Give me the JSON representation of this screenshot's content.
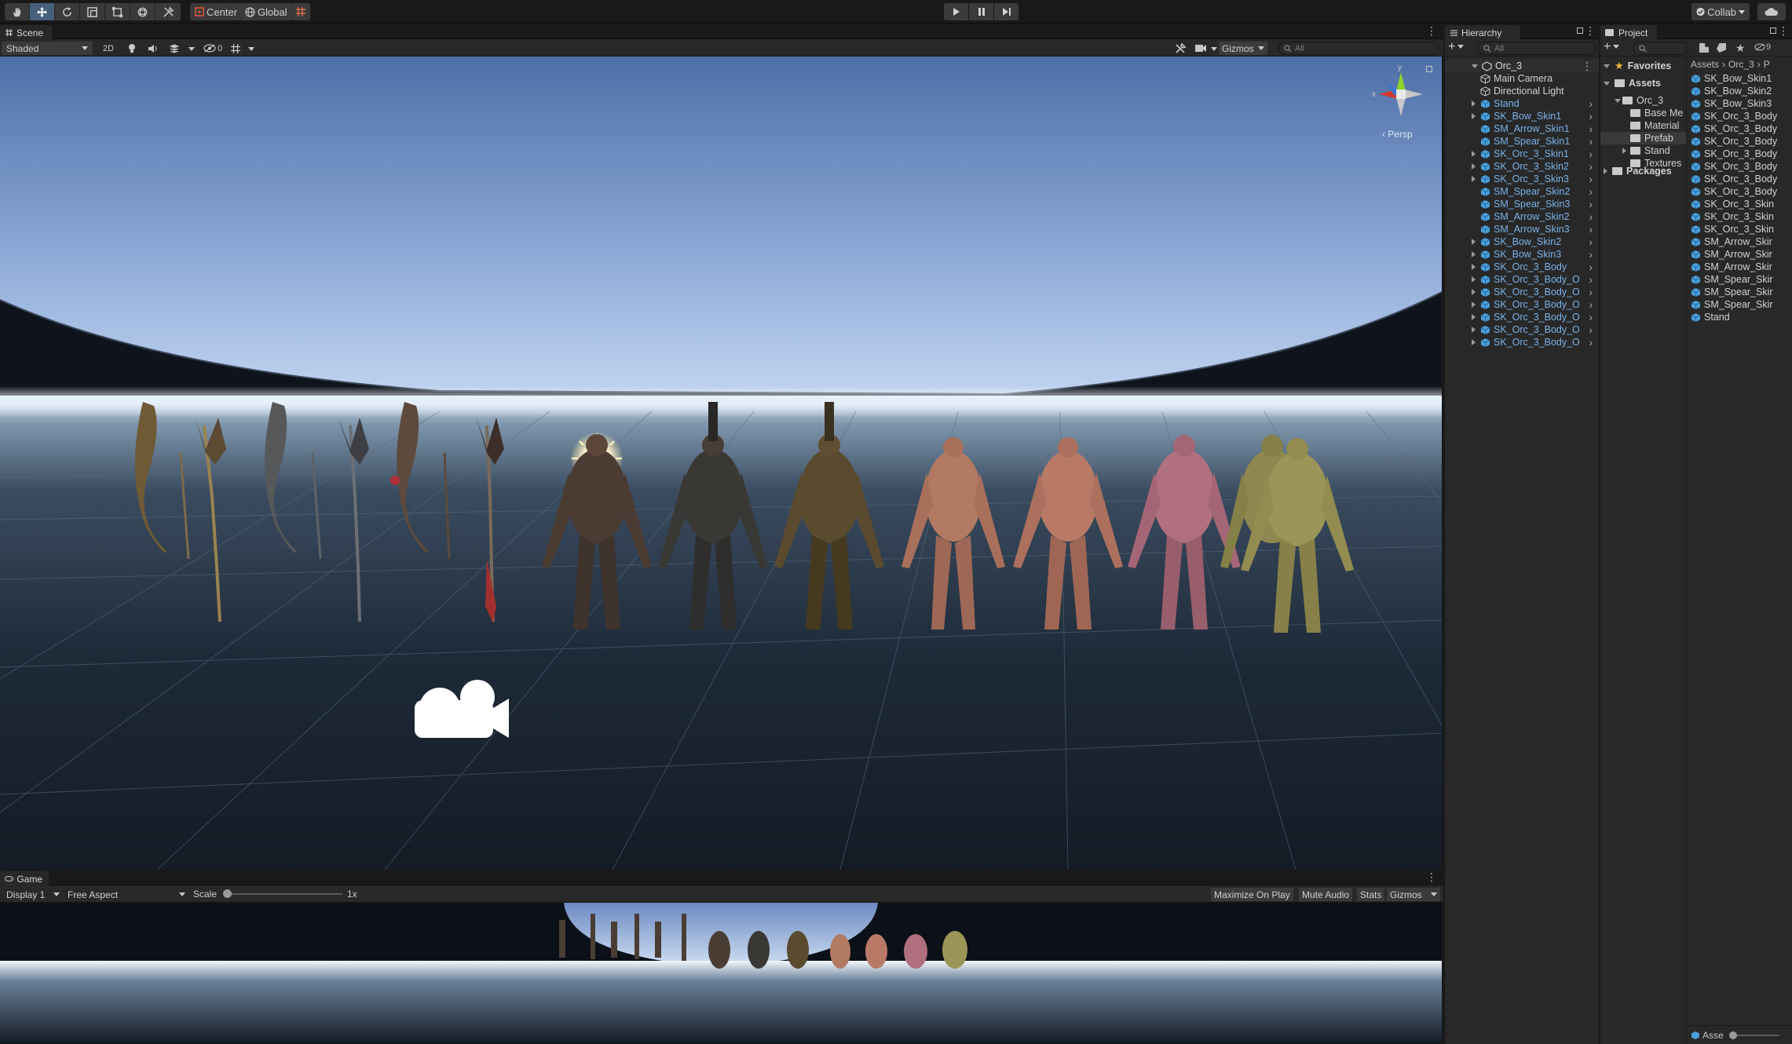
{
  "toolbar": {
    "pivot_label": "Center",
    "space_label": "Global",
    "collab_label": "Collab"
  },
  "scene": {
    "tab_label": "Scene",
    "shading_mode": "Shaded",
    "mode_2d": "2D",
    "hidden_count": "0",
    "gizmos_label": "Gizmos",
    "search_placeholder": "All",
    "persp_label": "‹ Persp",
    "axis_x": "x",
    "axis_y": "y"
  },
  "game": {
    "tab_label": "Game",
    "display": "Display 1",
    "aspect": "Free Aspect",
    "scale_label": "Scale",
    "scale_value": "1x",
    "scale_level": 0.0,
    "maximize_label": "Maximize On Play",
    "mute_label": "Mute Audio",
    "stats_label": "Stats",
    "gizmos_label": "Gizmos"
  },
  "hierarchy": {
    "tab_label": "Hierarchy",
    "search_placeholder": "All",
    "root": "Orc_3",
    "items": [
      {
        "label": "Main Camera",
        "type": "object",
        "expandable": false
      },
      {
        "label": "Directional Light",
        "type": "object",
        "expandable": false
      },
      {
        "label": "Stand",
        "type": "prefab",
        "expandable": true
      },
      {
        "label": "SK_Bow_Skin1",
        "type": "prefab",
        "expandable": true
      },
      {
        "label": "SM_Arrow_Skin1",
        "type": "prefab",
        "expandable": false
      },
      {
        "label": "SM_Spear_Skin1",
        "type": "prefab",
        "expandable": false
      },
      {
        "label": "SK_Orc_3_Skin1",
        "type": "prefab",
        "expandable": true
      },
      {
        "label": "SK_Orc_3_Skin2",
        "type": "prefab",
        "expandable": true
      },
      {
        "label": "SK_Orc_3_Skin3",
        "type": "prefab",
        "expandable": true
      },
      {
        "label": "SM_Spear_Skin2",
        "type": "prefab",
        "expandable": false
      },
      {
        "label": "SM_Spear_Skin3",
        "type": "prefab",
        "expandable": false
      },
      {
        "label": "SM_Arrow_Skin2",
        "type": "prefab",
        "expandable": false
      },
      {
        "label": "SM_Arrow_Skin3",
        "type": "prefab",
        "expandable": false
      },
      {
        "label": "SK_Bow_Skin2",
        "type": "prefab",
        "expandable": true
      },
      {
        "label": "SK_Bow_Skin3",
        "type": "prefab",
        "expandable": true
      },
      {
        "label": "SK_Orc_3_Body",
        "type": "prefab",
        "expandable": true
      },
      {
        "label": "SK_Orc_3_Body_O",
        "type": "prefab",
        "expandable": true
      },
      {
        "label": "SK_Orc_3_Body_O",
        "type": "prefab",
        "expandable": true
      },
      {
        "label": "SK_Orc_3_Body_O",
        "type": "prefab",
        "expandable": true
      },
      {
        "label": "SK_Orc_3_Body_O",
        "type": "prefab",
        "expandable": true
      },
      {
        "label": "SK_Orc_3_Body_O",
        "type": "prefab",
        "expandable": true
      },
      {
        "label": "SK_Orc_3_Body_O",
        "type": "prefab",
        "expandable": true
      }
    ]
  },
  "project": {
    "tab_label": "Project",
    "favorites_label": "Favorites",
    "assets_label": "Assets",
    "packages_label": "Packages",
    "breadcrumb": [
      "Assets",
      "Orc_3",
      "P"
    ],
    "hidden_count": "9",
    "tree": [
      {
        "label": "Orc_3",
        "level": 1,
        "open": true
      },
      {
        "label": "Base Me",
        "level": 2,
        "open": false
      },
      {
        "label": "Material",
        "level": 2,
        "open": false
      },
      {
        "label": "Prefab",
        "level": 2,
        "open": false,
        "selected": true
      },
      {
        "label": "Stand",
        "level": 2,
        "open": false,
        "expandable": true
      },
      {
        "label": "Textures",
        "level": 2,
        "open": false
      }
    ],
    "files": [
      "SK_Bow_Skin1",
      "SK_Bow_Skin2",
      "SK_Bow_Skin3",
      "SK_Orc_3_Body",
      "SK_Orc_3_Body",
      "SK_Orc_3_Body",
      "SK_Orc_3_Body",
      "SK_Orc_3_Body",
      "SK_Orc_3_Body",
      "SK_Orc_3_Body",
      "SK_Orc_3_Skin",
      "SK_Orc_3_Skin",
      "SK_Orc_3_Skin",
      "SM_Arrow_Skir",
      "SM_Arrow_Skir",
      "SM_Arrow_Skir",
      "SM_Spear_Skir",
      "SM_Spear_Skir",
      "SM_Spear_Skir",
      "Stand"
    ],
    "footer_label": "Asse"
  },
  "colors": {
    "accent": "#46607c",
    "prefab_text": "#7ab2e8",
    "prefab_icon": "#4aa0dc",
    "panel_bg": "#282828"
  }
}
